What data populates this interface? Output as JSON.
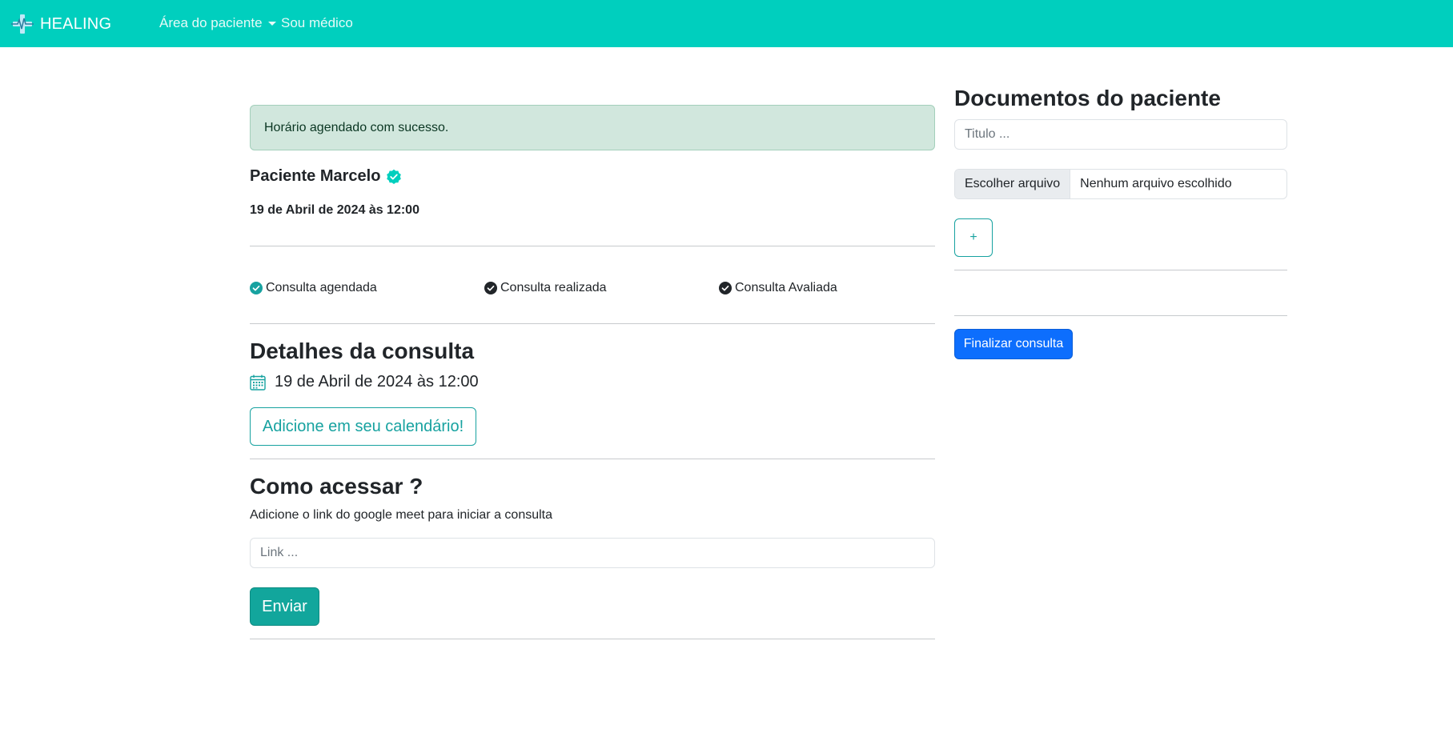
{
  "navbar": {
    "brand": "HEALING",
    "brand_icon": "heartbeat-logo-icon",
    "links": [
      {
        "label": "Área do paciente",
        "has_dropdown": true
      },
      {
        "label": "Sou médico",
        "has_dropdown": false
      }
    ]
  },
  "alert": {
    "text": "Horário agendado com sucesso."
  },
  "patient": {
    "name": "Paciente Marcelo",
    "verified_icon": "verified-badge-icon",
    "appointment_datetime": "19 de Abril de 2024 às 12:00"
  },
  "steps": [
    {
      "label": "Consulta agendada",
      "done": true,
      "color": "#17a2a0"
    },
    {
      "label": "Consulta realizada",
      "done": false,
      "color": "#212529"
    },
    {
      "label": "Consulta Avaliada",
      "done": false,
      "color": "#212529"
    }
  ],
  "details": {
    "title": "Detalhes da consulta",
    "date_text": "19 de Abril de 2024 às 12:00",
    "calendar_button": "Adicione em seu calendário!"
  },
  "access": {
    "title": "Como acessar ?",
    "help": "Adicione o link do google meet para iniciar a consulta",
    "link_placeholder": "Link ...",
    "send_button": "Enviar"
  },
  "documents": {
    "title": "Documentos do paciente",
    "title_placeholder": "Titulo ...",
    "file_button": "Escolher arquivo",
    "file_status": "Nenhum arquivo escolhido",
    "add_button": "+"
  },
  "finalize_button": "Finalizar consulta",
  "colors": {
    "navbar": "#00cfbe",
    "accent": "#17a2a0",
    "primary": "#0d6efd",
    "success_alert_bg": "#d1e7dd"
  }
}
